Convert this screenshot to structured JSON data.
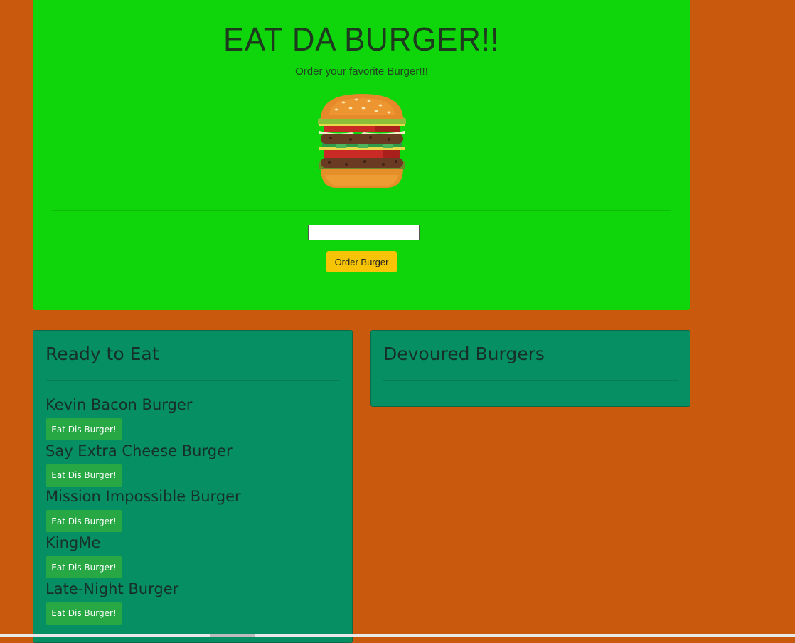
{
  "header": {
    "title": "EAT DA BURGER!!",
    "subtitle": "Order your favorite Burger!!!"
  },
  "form": {
    "input_value": "",
    "order_button_label": "Order Burger"
  },
  "ready": {
    "heading": "Ready to Eat",
    "items": [
      {
        "name": "Kevin Bacon Burger",
        "button": "Eat Dis Burger!"
      },
      {
        "name": "Say Extra Cheese Burger",
        "button": "Eat Dis Burger!"
      },
      {
        "name": "Mission Impossible Burger",
        "button": "Eat Dis Burger!"
      },
      {
        "name": "KingMe",
        "button": "Eat Dis Burger!"
      },
      {
        "name": "Late-Night Burger",
        "button": "Eat Dis Burger!"
      }
    ]
  },
  "devoured": {
    "heading": "Devoured Burgers",
    "items": []
  },
  "colors": {
    "page_background": "#c9590c",
    "jumbotron": "#0ed60b",
    "card": "#068f62",
    "order_button": "#f7c405",
    "eat_button": "#28a745"
  },
  "icons": {
    "hero_image": "burger-icon"
  }
}
